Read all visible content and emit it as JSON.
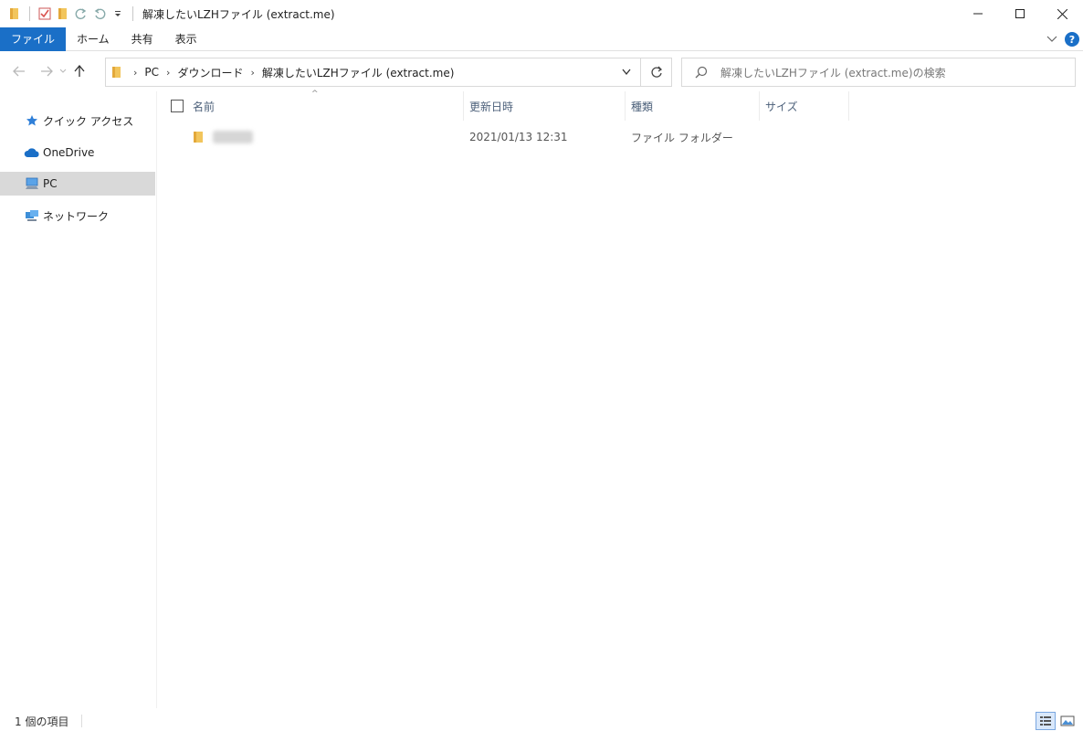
{
  "window": {
    "title": "解凍したいLZHファイル (extract.me)"
  },
  "ribbon": {
    "tabs": [
      {
        "label": "ファイル"
      },
      {
        "label": "ホーム"
      },
      {
        "label": "共有"
      },
      {
        "label": "表示"
      }
    ],
    "help_label": "?"
  },
  "address": {
    "crumbs": [
      "PC",
      "ダウンロード",
      "解凍したいLZHファイル (extract.me)"
    ],
    "search_placeholder": "解凍したいLZHファイル (extract.me)の検索"
  },
  "sidebar": {
    "items": [
      {
        "label": "クイック アクセス",
        "icon": "star-icon"
      },
      {
        "label": "OneDrive",
        "icon": "cloud-icon"
      },
      {
        "label": "PC",
        "icon": "computer-icon",
        "selected": true
      },
      {
        "label": "ネットワーク",
        "icon": "network-icon"
      }
    ]
  },
  "columns": [
    {
      "label": "名前"
    },
    {
      "label": "更新日時"
    },
    {
      "label": "種類"
    },
    {
      "label": "サイズ"
    }
  ],
  "files": [
    {
      "name": "",
      "modified": "2021/01/13 12:31",
      "type": "ファイル フォルダー",
      "size": ""
    }
  ],
  "status": {
    "item_count": "1 個の項目"
  },
  "colors": {
    "accent": "#1a6fc7",
    "folder": "#f2c55c",
    "selected_bg": "#d9d9d9"
  }
}
